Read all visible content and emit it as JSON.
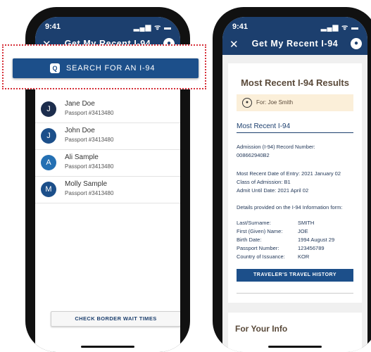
{
  "status": {
    "time": "9:41",
    "icons": "▂▄▆ ᯤ ▬"
  },
  "left": {
    "title": "Get My Recent I-94",
    "close": "✕",
    "search_button": "SEARCH FOR AN I-94",
    "search_glyph": "Q",
    "travelers": [
      {
        "initial": "J",
        "name": "Jane Doe",
        "passport": "Passport #3413480",
        "color": "#1c2d4d"
      },
      {
        "initial": "J",
        "name": "John Doe",
        "passport": "Passport #3413480",
        "color": "#1c4f8a"
      },
      {
        "initial": "A",
        "name": "Ali Sample",
        "passport": "Passport #3413480",
        "color": "#2470b3"
      },
      {
        "initial": "M",
        "name": "Molly Sample",
        "passport": "Passport #3413480",
        "color": "#1c4f8a"
      }
    ],
    "border_button": "CHECK BORDER WAIT TIMES"
  },
  "right": {
    "title": "Get My Recent I-94",
    "close": "✕",
    "results_title": "Most Recent I-94 Results",
    "for_label": "For: Joe Smith",
    "subheading": "Most Recent I-94",
    "admission_label": "Admission (I-94) Record Number:",
    "admission_number": "008662940B2",
    "entry_date": "Most Recent Date of Entry: 2021 January 02",
    "class_of_admission": "Class of Admission:  B1",
    "admit_until": "Admit Until Date:  2021 April 02",
    "details_note": "Details provided on the I-94 Information form:",
    "fields": [
      {
        "label": "Last/Surname:",
        "value": "SMITH"
      },
      {
        "label": "First (Given) Name:",
        "value": "JOE"
      },
      {
        "label": "Birth Date:",
        "value": "1994 August 29"
      },
      {
        "label": "Passport Number:",
        "value": "123456789"
      },
      {
        "label": "Country of Issuance:",
        "value": "KOR"
      }
    ],
    "history_button": "TRAVELER'S TRAVEL HISTORY",
    "info_title": "For Your Info"
  }
}
